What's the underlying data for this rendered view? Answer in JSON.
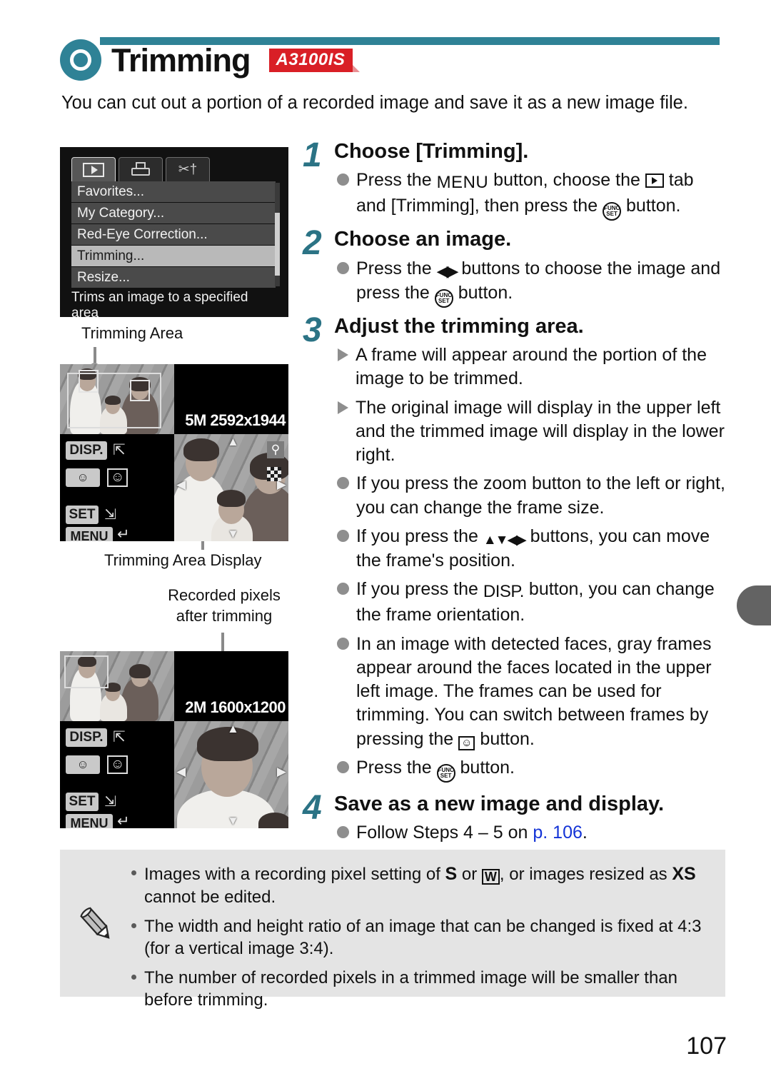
{
  "header": {
    "title": "Trimming",
    "badge": "A3100IS",
    "icon": "teal-ring-icon",
    "accent_color": "#2f8296",
    "badge_color": "#d91f26"
  },
  "intro": "You can cut out a portion of a recorded image and save it as a new image file.",
  "menu_screenshot": {
    "tabs": [
      {
        "name": "playback-tab",
        "icon": "play-icon",
        "active": true
      },
      {
        "name": "print-tab",
        "icon": "printer-icon",
        "active": false
      },
      {
        "name": "settings-tab",
        "icon": "wrench-tool-icon",
        "active": false
      }
    ],
    "items": [
      {
        "label": "Favorites...",
        "selected": false
      },
      {
        "label": "My Category...",
        "selected": false
      },
      {
        "label": "Red-Eye Correction...",
        "selected": false
      },
      {
        "label": "Trimming...",
        "selected": true
      },
      {
        "label": "Resize...",
        "selected": false
      }
    ],
    "help_text": "Trims an image to a specified area"
  },
  "figures": {
    "caption_trimming_area": "Trimming Area",
    "caption_trimming_area_display": "Trimming Area Display",
    "caption_recorded_pixels": "Recorded pixels\nafter trimming",
    "caption_recorded_pixels_line1": "Recorded pixels",
    "caption_recorded_pixels_line2": "after trimming",
    "display_original": {
      "resolution": "5M 2592x1944",
      "disp_label": "DISP.",
      "set_label": "SET",
      "menu_label": "MENU"
    },
    "display_trimmed": {
      "resolution": "2M 1600x1200",
      "disp_label": "DISP.",
      "set_label": "SET",
      "menu_label": "MENU"
    }
  },
  "steps": [
    {
      "number": "1",
      "title": "Choose [Trimming].",
      "bullets": [
        {
          "marker": "dot",
          "parts": [
            {
              "t": "text",
              "v": "Press the "
            },
            {
              "t": "glyph",
              "v": "MENU"
            },
            {
              "t": "text",
              "v": " button, choose the "
            },
            {
              "t": "glyph",
              "v": "playback-tab-icon"
            },
            {
              "t": "text",
              "v": " tab and [Trimming], then press the "
            },
            {
              "t": "glyph",
              "v": "func-set-icon"
            },
            {
              "t": "text",
              "v": " button."
            }
          ]
        }
      ]
    },
    {
      "number": "2",
      "title": "Choose an image.",
      "bullets": [
        {
          "marker": "dot",
          "parts": [
            {
              "t": "text",
              "v": "Press the "
            },
            {
              "t": "glyph",
              "v": "left-right-arrows-icon"
            },
            {
              "t": "text",
              "v": " buttons to choose the image and press the "
            },
            {
              "t": "glyph",
              "v": "func-set-icon"
            },
            {
              "t": "text",
              "v": " button."
            }
          ]
        }
      ]
    },
    {
      "number": "3",
      "title": "Adjust the trimming area.",
      "bullets": [
        {
          "marker": "triangle",
          "text": "A frame will appear around the portion of the image to be trimmed."
        },
        {
          "marker": "triangle",
          "text": "The original image will display in the upper left and the trimmed image will display in the lower right."
        },
        {
          "marker": "dot",
          "text": "If you press the zoom button to the left or right, you can change the frame size."
        },
        {
          "marker": "dot",
          "text_a": "If you press the ",
          "glyph": "updown-leftright-arrows-icon",
          "text_b": " buttons, you can move the frame's position."
        },
        {
          "marker": "dot",
          "text_a": "If you press the ",
          "glyph": "disp-button-icon",
          "text_b": " button, you can change the frame orientation."
        },
        {
          "marker": "dot",
          "text_a": "In an image with detected faces, gray frames appear around the faces located in the upper left image. The frames can be used for trimming. You can switch between frames by pressing the ",
          "glyph": "face-select-icon",
          "text_b": " button."
        },
        {
          "marker": "dot",
          "text_a": "Press the ",
          "glyph": "func-set-icon",
          "text_b": " button."
        }
      ]
    },
    {
      "number": "4",
      "title": "Save as a new image and display.",
      "bullets": [
        {
          "marker": "dot",
          "text_a": "Follow Steps 4 – 5 on ",
          "link": "p. 106",
          "text_b": "."
        }
      ]
    }
  ],
  "note": {
    "icon": "pencil-icon",
    "items": [
      {
        "text_a": "Images with a recording pixel setting of ",
        "glyph_a": "S",
        "text_b": " or ",
        "glyph_b": "W",
        "text_c": ", or images resized as ",
        "glyph_c": "XS",
        "text_d": " cannot be edited."
      },
      {
        "text": "The width and height ratio of an image that can be changed is fixed at 4:3 (for a vertical image 3:4)."
      },
      {
        "text": "The number of recorded pixels in a trimmed image will be smaller than before trimming."
      }
    ]
  },
  "page_number": "107"
}
